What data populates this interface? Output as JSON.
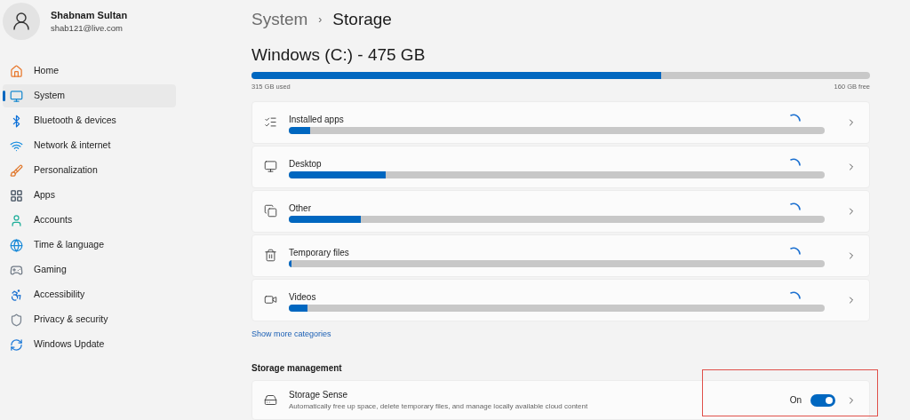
{
  "user": {
    "name": "Shabnam Sultan",
    "email": "shab121@live.com"
  },
  "sidebar": {
    "items": [
      {
        "label": "Home",
        "selected": false
      },
      {
        "label": "System",
        "selected": true
      },
      {
        "label": "Bluetooth & devices",
        "selected": false
      },
      {
        "label": "Network & internet",
        "selected": false
      },
      {
        "label": "Personalization",
        "selected": false
      },
      {
        "label": "Apps",
        "selected": false
      },
      {
        "label": "Accounts",
        "selected": false
      },
      {
        "label": "Time & language",
        "selected": false
      },
      {
        "label": "Gaming",
        "selected": false
      },
      {
        "label": "Accessibility",
        "selected": false
      },
      {
        "label": "Privacy & security",
        "selected": false
      },
      {
        "label": "Windows Update",
        "selected": false
      }
    ]
  },
  "breadcrumb": {
    "parent": "System",
    "separator": "›",
    "current": "Storage"
  },
  "drive": {
    "title": "Windows (C:) - 475 GB",
    "level": 0.663,
    "used": "315 GB used",
    "free": "160 GB free"
  },
  "categories": [
    {
      "label": "Installed apps",
      "level": 0.04
    },
    {
      "label": "Desktop",
      "level": 0.18
    },
    {
      "label": "Other",
      "level": 0.135
    },
    {
      "label": "Temporary files",
      "level": 0.005
    },
    {
      "label": "Videos",
      "level": 0.035
    }
  ],
  "show_more": "Show more categories",
  "storage_management": {
    "heading": "Storage management",
    "items": [
      {
        "title": "Storage Sense",
        "description": "Automatically free up space, delete temporary files, and manage locally available cloud content",
        "state_label": "On",
        "on": true
      }
    ]
  }
}
